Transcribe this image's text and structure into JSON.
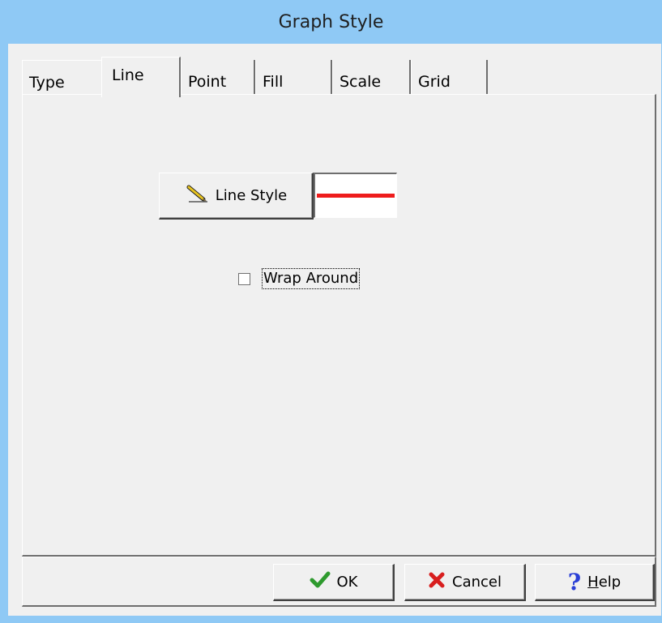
{
  "window": {
    "title": "Graph Style"
  },
  "tabs": [
    {
      "label": "Type"
    },
    {
      "label": "Line",
      "active": true
    },
    {
      "label": "Point"
    },
    {
      "label": "Fill"
    },
    {
      "label": "Scale"
    },
    {
      "label": "Grid"
    }
  ],
  "line_tab": {
    "line_style_button": "Line Style",
    "line_color": "#ee1c1c",
    "wrap_around_label": "Wrap Around",
    "wrap_around_checked": false
  },
  "footer": {
    "ok_label": "OK",
    "cancel_label": "Cancel",
    "help_label_accel": "H",
    "help_label_rest": "elp"
  },
  "icons": {
    "line_style": "pencil-icon",
    "ok": "checkmark-icon",
    "cancel": "x-icon",
    "help": "question-mark-icon"
  }
}
